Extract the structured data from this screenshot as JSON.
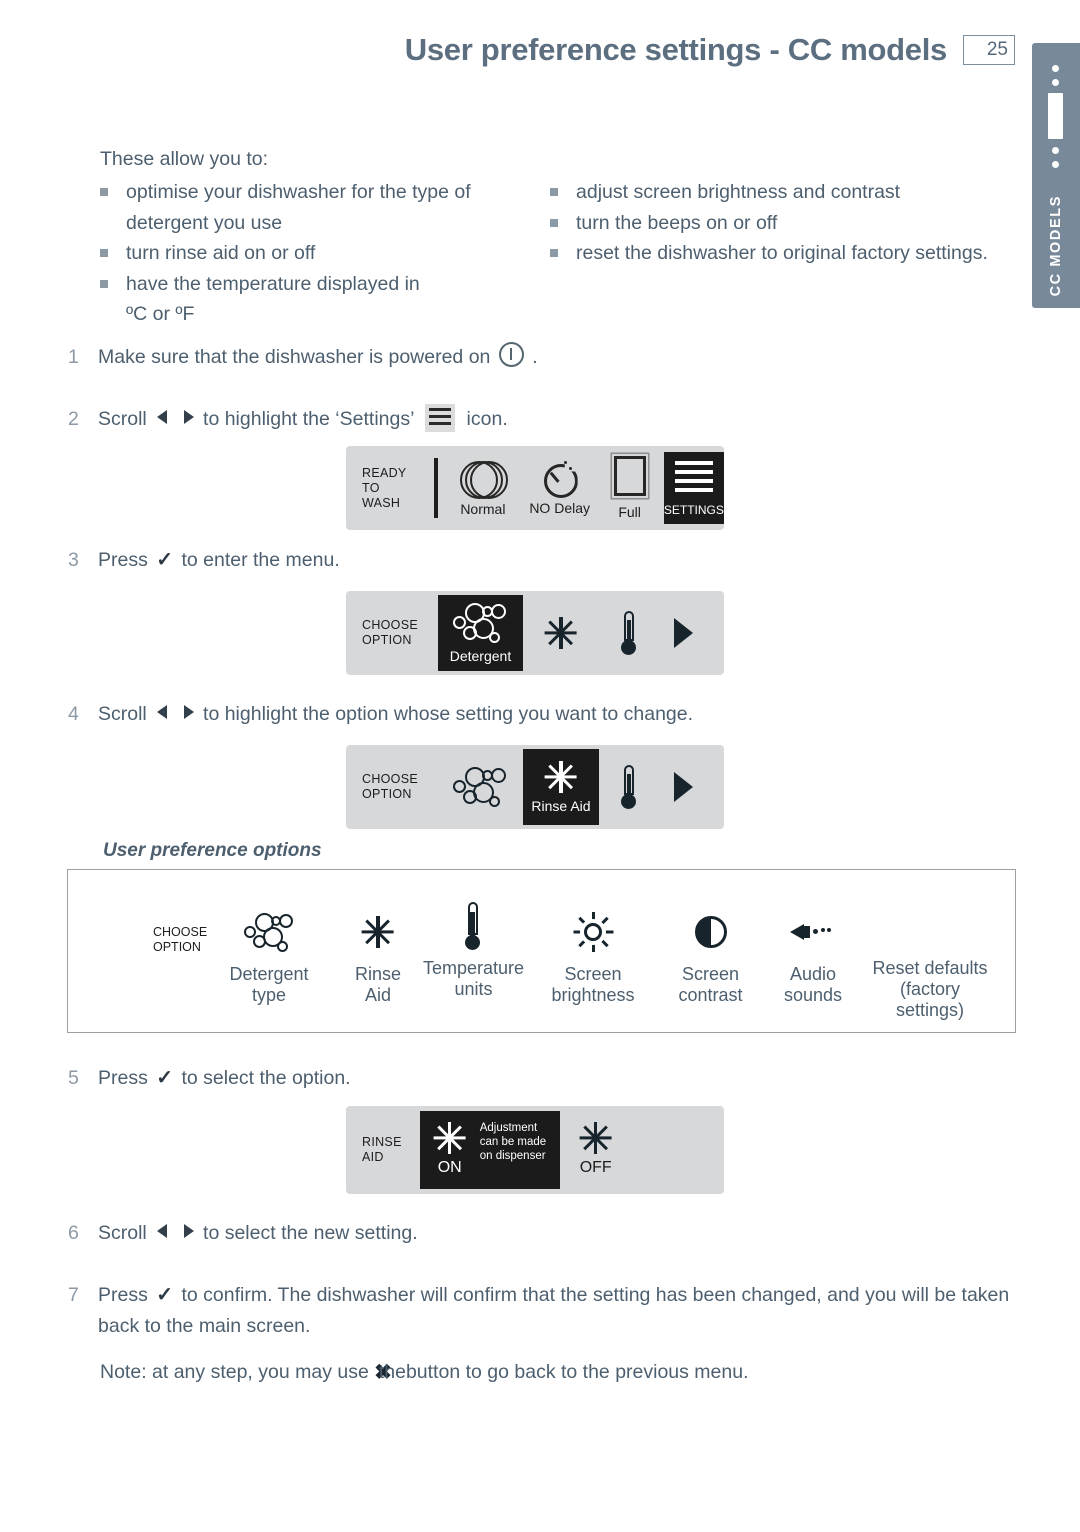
{
  "header": {
    "title_main": "User preference settings",
    "title_sub": "- CC models",
    "page_number": "25"
  },
  "side_tab": {
    "label": "CC MODELS"
  },
  "intro": {
    "lead": "These allow you to:",
    "left_bullets": [
      "optimise your dishwasher for the type of detergent you use",
      "turn rinse aid on or off",
      "have the temperature displayed in"
    ],
    "left_extra": "ºC or ºF",
    "right_bullets": [
      "adjust screen brightness and contrast",
      "turn the beeps on or off",
      "reset the dishwasher to original factory settings."
    ]
  },
  "steps": {
    "s1": {
      "num": "1",
      "before": "Make sure that the dishwasher is powered on",
      "after": "."
    },
    "s2": {
      "num": "2",
      "a": "Scroll",
      "b": "to highlight the ‘Settings’",
      "c": "icon."
    },
    "s3": {
      "num": "3",
      "a": "Press",
      "b": "to enter the menu."
    },
    "s4": {
      "num": "4",
      "a": "Scroll",
      "b": "to highlight the option whose setting you want to change."
    },
    "s5": {
      "num": "5",
      "a": "Press",
      "b": "to select the option."
    },
    "s6": {
      "num": "6",
      "a": "Scroll",
      "b": "to select the new setting."
    },
    "s7": {
      "num": "7",
      "a": "Press",
      "b": "to confirm. The dishwasher will confirm that the setting has been changed, and you will be taken back to the main screen."
    }
  },
  "panel_ready": {
    "status": "READY\nTO WASH",
    "cells": [
      {
        "caption": "Normal",
        "icon": "plates-icon",
        "selected": false
      },
      {
        "caption": "NO Delay",
        "icon": "clock-icon",
        "selected": false
      },
      {
        "caption": "Full",
        "icon": "rack-icon",
        "selected": false
      },
      {
        "caption": "SETTINGS",
        "icon": "settings-icon",
        "selected": true
      }
    ]
  },
  "panel_detergent": {
    "status": "CHOOSE\nOPTION",
    "cells": [
      {
        "caption": "Detergent",
        "icon": "bubbles-icon",
        "selected": true
      },
      {
        "caption": "",
        "icon": "snowflake-icon",
        "selected": false
      },
      {
        "caption": "",
        "icon": "thermometer-icon",
        "selected": false
      },
      {
        "caption": "",
        "icon": "play-arrow-icon",
        "selected": false
      }
    ]
  },
  "panel_rinse": {
    "status": "CHOOSE\nOPTION",
    "cells": [
      {
        "caption": "",
        "icon": "bubbles-icon",
        "selected": false
      },
      {
        "caption": "Rinse Aid",
        "icon": "snowflake-icon",
        "selected": true
      },
      {
        "caption": "",
        "icon": "thermometer-icon",
        "selected": false
      },
      {
        "caption": "",
        "icon": "play-arrow-icon",
        "selected": false
      }
    ]
  },
  "panel_rinse_onoff": {
    "status": "RINSE\nAID",
    "on_caption": "ON",
    "on_note": "Adjustment\ncan be made\non dispenser",
    "off_caption": "OFF"
  },
  "options_box": {
    "title": "User preference options",
    "choose_option": "CHOOSE\nOPTION",
    "items": [
      {
        "icon": "bubbles-icon",
        "label": "Detergent\ntype"
      },
      {
        "icon": "snowflake-icon",
        "label": "Rinse\nAid"
      },
      {
        "icon": "thermometer-icon",
        "label": "Temperature\nunits"
      },
      {
        "icon": "sun-icon",
        "label": "Screen\nbrightness"
      },
      {
        "icon": "contrast-icon",
        "label": "Screen\ncontrast"
      },
      {
        "icon": "speaker-icon",
        "label": "Audio\nsounds"
      },
      {
        "icon": "none",
        "label": "Reset defaults\n(factory\nsettings)"
      }
    ]
  },
  "note": {
    "a": "Note: at any step, you may use",
    "x": "✖",
    "b": "the",
    "c": "button to go back to the previous menu."
  },
  "colors": {
    "text": "#4d5f6e",
    "tab": "#78899a",
    "panel_bg": "#d7d8da",
    "selected_bg": "#1b1b1b"
  }
}
